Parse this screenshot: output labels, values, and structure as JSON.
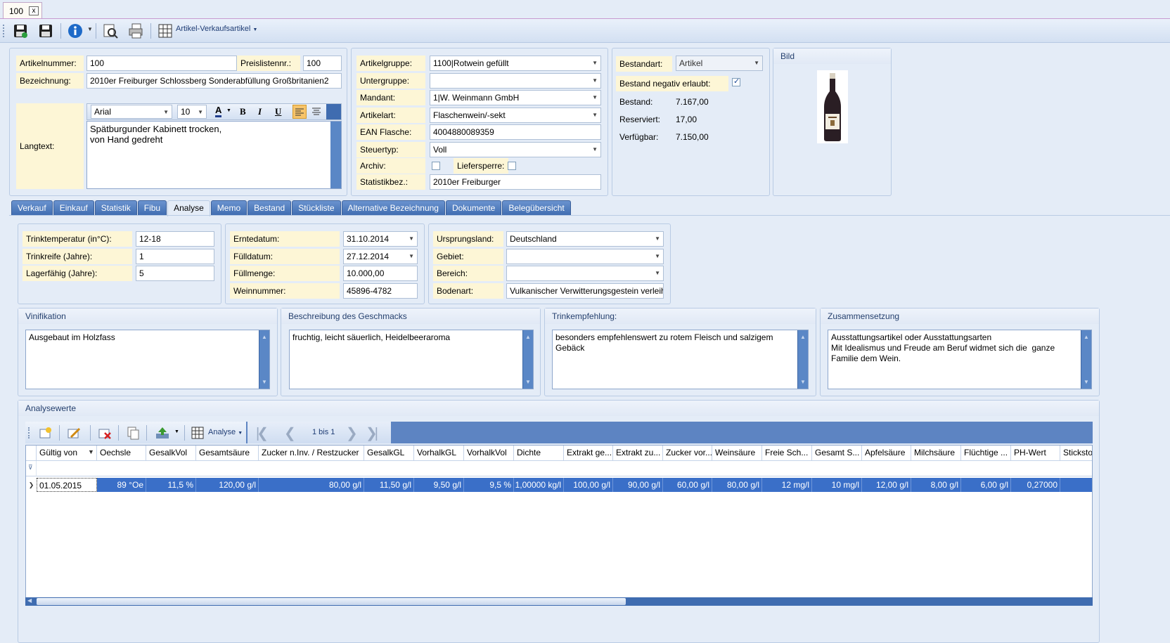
{
  "doc_tab": {
    "label": "100",
    "close": "x"
  },
  "toolbar": {
    "layout_label": "Artikel-Verkaufsartikel"
  },
  "header": {
    "artikelnummer": {
      "label": "Artikelnummer:",
      "value": "100"
    },
    "preislistennr": {
      "label": "Preislistennr.:",
      "value": "100"
    },
    "bezeichnung": {
      "label": "Bezeichnung:",
      "value": "2010er Freiburger Schlossberg Sonderabfüllung Großbritanien2"
    },
    "langtext": {
      "label": "Langtext:",
      "font": "Arial",
      "size": "10",
      "text": "Spätburgunder Kabinett trocken,\nvon Hand gedreht"
    },
    "artikelgruppe": {
      "label": "Artikelgruppe:",
      "value": "1100|Rotwein gefüllt"
    },
    "untergruppe": {
      "label": "Untergruppe:",
      "value": ""
    },
    "mandant": {
      "label": "Mandant:",
      "value": "1|W. Weinmann GmbH"
    },
    "artikelart": {
      "label": "Artikelart:",
      "value": "Flaschenwein/-sekt"
    },
    "ean": {
      "label": "EAN Flasche:",
      "value": "4004880089359"
    },
    "steuertyp": {
      "label": "Steuertyp:",
      "value": "Voll"
    },
    "archiv": {
      "label": "Archiv:"
    },
    "liefersperre": {
      "label": "Liefersperre:"
    },
    "statistikbez": {
      "label": "Statistikbez.:",
      "value": "2010er Freiburger"
    },
    "bestandart": {
      "label": "Bestandart:",
      "value": "Artikel"
    },
    "bestand_negativ": {
      "label": "Bestand negativ erlaubt:"
    },
    "bestand": {
      "label": "Bestand:",
      "value": "7.167,00"
    },
    "reserviert": {
      "label": "Reserviert:",
      "value": "17,00"
    },
    "verfuegbar": {
      "label": "Verfügbar:",
      "value": "7.150,00"
    },
    "bild": {
      "label": "Bild"
    }
  },
  "tabs": [
    "Verkauf",
    "Einkauf",
    "Statistik",
    "Fibu",
    "Analyse",
    "Memo",
    "Bestand",
    "Stückliste",
    "Alternative Bezeichnung",
    "Dokumente",
    "Belegübersicht"
  ],
  "analyse": {
    "trinktemperatur": {
      "label": "Trinktemperatur (in°C):",
      "value": "12-18"
    },
    "trinkreife": {
      "label": "Trinkreife (Jahre):",
      "value": "1"
    },
    "lagerfaehig": {
      "label": "Lagerfähig (Jahre):",
      "value": "5"
    },
    "erntedatum": {
      "label": "Erntedatum:",
      "value": "31.10.2014"
    },
    "fuelldatum": {
      "label": "Fülldatum:",
      "value": "27.12.2014"
    },
    "fuellmenge": {
      "label": "Füllmenge:",
      "value": "10.000,00"
    },
    "weinnummer": {
      "label": "Weinnummer:",
      "value": "45896-4782"
    },
    "ursprungsland": {
      "label": "Ursprungsland:",
      "value": "Deutschland"
    },
    "gebiet": {
      "label": "Gebiet:",
      "value": ""
    },
    "bereich": {
      "label": "Bereich:",
      "value": ""
    },
    "bodenart": {
      "label": "Bodenart:",
      "value": "Vulkanischer Verwitterungsgestein verleih"
    },
    "vinifikation": {
      "title": "Vinifikation",
      "text": "Ausgebaut im Holzfass"
    },
    "geschmack": {
      "title": "Beschreibung des Geschmacks",
      "text": "fruchtig, leicht säuerlich, Heidelbeeraroma"
    },
    "trinkempfehlung": {
      "title": "Trinkempfehlung:",
      "text": "besonders empfehlenswert zu rotem Fleisch und salzigem Gebäck"
    },
    "zusammensetzung": {
      "title": "Zusammensetzung",
      "text": "Ausstattungsartikel oder Ausstattungsarten\nMit Idealismus und Freude am Beruf widmet sich die  ganze Familie dem Wein."
    }
  },
  "analysewerte": {
    "title": "Analysewerte",
    "toolbar_layout": "Analyse",
    "pager": "1 bis 1",
    "columns": [
      "Gültig von",
      "Oechsle",
      "GesalkVol",
      "Gesamtsäure",
      "Zucker n.Inv. / Restzucker",
      "GesalkGL",
      "VorhalkGL",
      "VorhalkVol",
      "Dichte",
      "Extrakt ge...",
      "Extrakt zu...",
      "Zucker vor...",
      "Weinsäure",
      "Freie Sch...",
      "Gesamt S...",
      "Apfelsäure",
      "Milchsäure",
      "Flüchtige ...",
      "PH-Wert",
      "Stickstof"
    ],
    "row": [
      "01.05.2015",
      "89 °Oe",
      "11,5 %",
      "120,00 g/l",
      "80,00 g/l",
      "11,50 g/l",
      "9,50 g/l",
      "9,5 %",
      "1,00000 kg/l",
      "100,00 g/l",
      "90,00 g/l",
      "60,00 g/l",
      "80,00 g/l",
      "12 mg/l",
      "10 mg/l",
      "12,00 g/l",
      "8,00 g/l",
      "6,00 g/l",
      "0,27000",
      ""
    ]
  }
}
